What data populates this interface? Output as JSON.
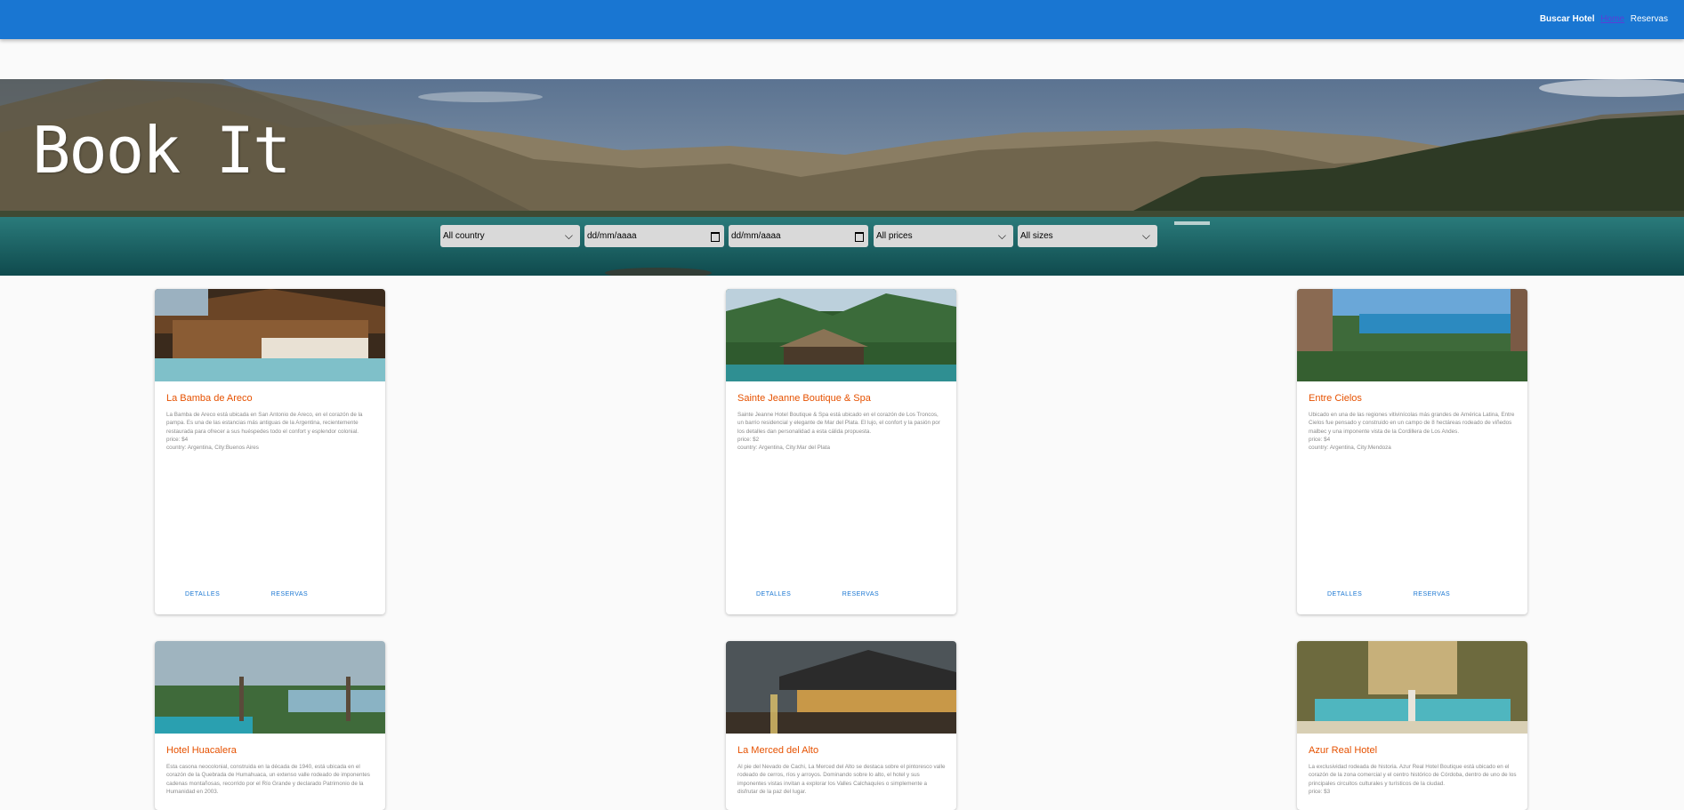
{
  "nav": {
    "brand": "Buscar Hotel",
    "home": "Home",
    "reservas": "Reservas"
  },
  "hero": {
    "title": "Book It",
    "filters": {
      "country": "All country",
      "date_from": "dd/mm/aaaa",
      "date_to": "dd/mm/aaaa",
      "prices": "All prices",
      "sizes": "All sizes"
    }
  },
  "actions": {
    "details": "DETALLES",
    "reserve": "RESERVAS"
  },
  "hotels": [
    {
      "name": "La Bamba de Areco",
      "description": "La Bamba de Areco está ubicada en San Antonio de Areco, en el corazón de la pampa. Es una de las estancias más antiguas de la Argentina, recientemente restaurada para ofrecer a sus huéspedes todo el confort y esplendor colonial.",
      "price": "price: $4",
      "location": "country: Argentina, City:Buenos Aires"
    },
    {
      "name": "Sainte Jeanne Boutique & Spa",
      "description": "Sainte Jeanne Hotel Boutique & Spa está ubicado en el corazón de Los Troncos, un barrio residencial y elegante de Mar del Plata. El lujo, el confort y la pasión por los detalles dan personalidad a esta cálida propuesta.",
      "price": "price: $2",
      "location": "country: Argentina, City:Mar del Plata"
    },
    {
      "name": "Entre Cielos",
      "description": "Ubicado en una de las regiones vitivinícolas más grandes de América Latina, Entre Cielos fue pensado y construido en un campo de 8 hectáreas rodeado de viñedos malbec y una imponente vista de la Cordillera de Los Andes.",
      "price": "price: $4",
      "location": "country: Argentina, City:Mendoza"
    },
    {
      "name": "Hotel Huacalera",
      "description": "Esta casona neocolonial, construida en la década de 1940, está ubicada en el corazón de la Quebrada de Humahuaca, un extenso valle rodeado de imponentes cadenas montañosas, recorrido por el Río Grande y declarado Patrimonio de la Humanidad en 2003.",
      "price": "",
      "location": ""
    },
    {
      "name": "La Merced del Alto",
      "description": "Al pie del Nevado de Cachi, La Merced del Alto se destaca sobre el pintoresco valle rodeado de cerros, ríos y arroyos. Dominando sobre lo alto, el hotel y sus imponentes vistas invitan a explorar los Valles Calchaquíes o simplemente a disfrutar de la paz del lugar.",
      "price": "",
      "location": ""
    },
    {
      "name": "Azur Real Hotel",
      "description": "La exclusividad rodeada de historia. Azur Real Hotel Boutique está ubicado en el corazón de la zona comercial y el centro histórico de Córdoba, dentro de uno de los principales circuitos culturales y turísticos de la ciudad.",
      "price": "price: $3",
      "location": ""
    }
  ]
}
